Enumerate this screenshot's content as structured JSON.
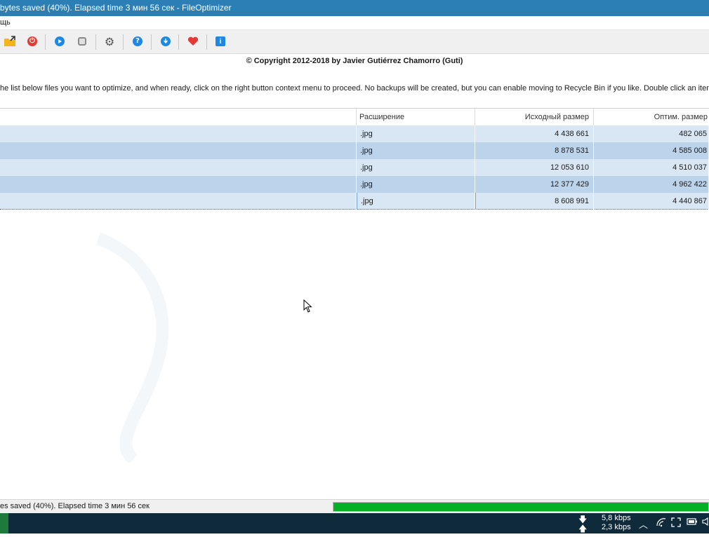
{
  "window": {
    "title": "bytes saved (40%). Elapsed time  3 мин 56 сек - FileOptimizer"
  },
  "menu": {
    "partial_item": "щь"
  },
  "toolbar": {
    "buttons": [
      {
        "icon": "folder-add-icon",
        "color": "#f2b51c"
      },
      {
        "icon": "power-icon",
        "color": "#e53935"
      },
      {
        "icon": "play-icon",
        "color": "#1e88e5"
      },
      {
        "icon": "stop-icon",
        "color": "#9e9e9e"
      },
      {
        "icon": "gear-icon",
        "color": "#555555"
      },
      {
        "icon": "help-icon",
        "color": "#1e88e5"
      },
      {
        "icon": "download-icon",
        "color": "#1e88e5"
      },
      {
        "icon": "heart-icon",
        "color": "#e53935"
      },
      {
        "icon": "info-icon",
        "color": "#1e88e5"
      }
    ]
  },
  "copyright": "© Copyright 2012-2018 by Javier Gutiérrez Chamorro (Guti)",
  "instructions": "he list below files you want to optimize, and when ready, click on the right button context menu to proceed. No backups will be created, but you can enable moving to Recycle Bin if you like. Double click an item to p",
  "table": {
    "columns": [
      "",
      "Расширение",
      "Исходный размер",
      "Оптим. размер"
    ],
    "rows": [
      {
        "ext": ".jpg",
        "original": "4 438 661",
        "optimized": "482 065"
      },
      {
        "ext": ".jpg",
        "original": "8 878 531",
        "optimized": "4 585 008"
      },
      {
        "ext": ".jpg",
        "original": "12 053 610",
        "optimized": "4 510 037"
      },
      {
        "ext": ".jpg",
        "original": "12 377 429",
        "optimized": "4 962 422"
      },
      {
        "ext": ".jpg",
        "original": "8 608 991",
        "optimized": "4 440 867"
      }
    ]
  },
  "status": {
    "text": "es saved (40%). Elapsed time  3 мин 56 сек",
    "progress": 1.0,
    "progress_color": "#06b025"
  },
  "taskbar": {
    "download_speed": "5,8 kbps",
    "upload_speed": "2,3 kbps"
  }
}
